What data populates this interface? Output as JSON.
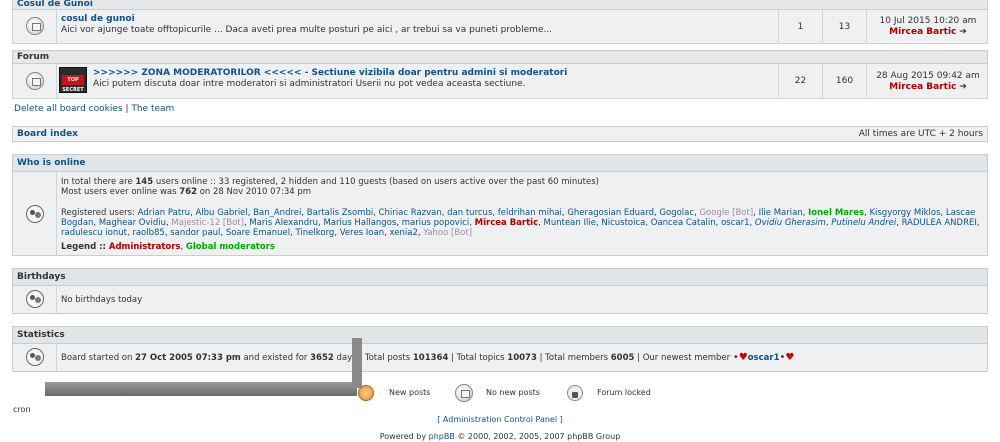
{
  "cat_gunoi": {
    "header": "Cosul de Gunoi",
    "forum_title": "cosul de gunoi",
    "forum_desc": "Aici vor ajunge toate offtopicurile ... Daca aveti prea multe posturi pe aici , ar trebui sa va puneti probleme...",
    "topics": "1",
    "posts": "13",
    "last_date": "10 Jul 2015 10:20 am",
    "last_user": "Mircea Bartic"
  },
  "cat_forum": {
    "header": "Forum",
    "image_text": "TOP SECRET",
    "forum_title": ">>>>>> ZONA MODERATORILOR <<<<< - Sectiune vizibila doar pentru admini si moderatori",
    "forum_desc": "Aici putem discuta doar intre moderatori si administratori Userii nu pot vedea aceasta sectiune.",
    "topics": "22",
    "posts": "160",
    "last_date": "28 Aug 2015 09:42 am",
    "last_user": "Mircea Bartic"
  },
  "links": {
    "delete_cookies": "Delete all board cookies",
    "separator": "|",
    "team": "The team"
  },
  "navbar": {
    "board_index": "Board index",
    "timezone": "All times are UTC + 2 hours"
  },
  "online": {
    "header": "Who is online",
    "line1_a": "In total there are ",
    "line1_count": "145",
    "line1_b": " users online :: 33 registered, 2 hidden and 110 guests (based on users active over the past 60 minutes)",
    "line2_a": "Most users ever online was ",
    "line2_count": "762",
    "line2_b": " on 28 Nov 2010 07:34 pm",
    "registered_label": "Registered users: ",
    "users": [
      {
        "name": "Adrian Patru",
        "type": "user"
      },
      {
        "name": "Albu Gabriel",
        "type": "user"
      },
      {
        "name": "Ban_Andrei",
        "type": "user"
      },
      {
        "name": "Bartalis Zsombi",
        "type": "user"
      },
      {
        "name": "Chiriac Razvan",
        "type": "user"
      },
      {
        "name": "dan turcus",
        "type": "user"
      },
      {
        "name": "feldrihan mihai",
        "type": "user"
      },
      {
        "name": "Gheragosian Eduard",
        "type": "user"
      },
      {
        "name": "Gogolac",
        "type": "user"
      },
      {
        "name": "Google [Bot]",
        "type": "bot"
      },
      {
        "name": "Ilie Marian",
        "type": "user"
      },
      {
        "name": "Ionel Mares",
        "type": "mod"
      },
      {
        "name": "Kisgyorgy Miklos",
        "type": "user"
      },
      {
        "name": "Lascae Bogdan",
        "type": "user"
      },
      {
        "name": "Maghear Ovidiu",
        "type": "user"
      },
      {
        "name": "Majestic-12 [Bot]",
        "type": "bot"
      },
      {
        "name": "Maris Alexandru",
        "type": "user"
      },
      {
        "name": "Marius Hallangos",
        "type": "user"
      },
      {
        "name": "marius popovici",
        "type": "user"
      },
      {
        "name": "Mircea Bartic",
        "type": "admin"
      },
      {
        "name": "Muntean Ilie",
        "type": "user"
      },
      {
        "name": "Nicustoica",
        "type": "user"
      },
      {
        "name": "Oancea Catalin",
        "type": "user"
      },
      {
        "name": "oscar1",
        "type": "user"
      },
      {
        "name": "Ovidiu Gherasim",
        "type": "italic"
      },
      {
        "name": "Putinelu Andrei",
        "type": "italic"
      },
      {
        "name": "RADULEA ANDREI",
        "type": "user"
      },
      {
        "name": "radulescu ionut",
        "type": "user"
      },
      {
        "name": "raolb85",
        "type": "user"
      },
      {
        "name": "sandor paul",
        "type": "user"
      },
      {
        "name": "Soare Emanuel",
        "type": "user"
      },
      {
        "name": "Tinelkorg",
        "type": "user"
      },
      {
        "name": "Veres Ioan",
        "type": "user"
      },
      {
        "name": "xenia2",
        "type": "user"
      },
      {
        "name": "Yahoo [Bot]",
        "type": "bot"
      }
    ],
    "legend_label": "Legend :: ",
    "legend_admins": "Administrators",
    "legend_sep": ", ",
    "legend_mods": "Global moderators"
  },
  "birthdays": {
    "header": "Birthdays",
    "text": "No birthdays today"
  },
  "stats": {
    "header": "Statistics",
    "a": "Board started on ",
    "started": "27 Oct 2005 07:33 pm",
    "b": " and existed for ",
    "days": "3652",
    "c": " days | Total posts ",
    "posts": "101364",
    "d": " | Total topics ",
    "topics": "10073",
    "e": " | Total members ",
    "members": "6005",
    "f": " | Our newest member ",
    "newest": "oscar1"
  },
  "legend_icons": {
    "new_posts": "New posts",
    "no_new_posts": "No new posts",
    "forum_locked": "Forum locked"
  },
  "footer": {
    "cron": "cron",
    "acp": "[ Administration Control Panel ]",
    "powered_a": "Powered by ",
    "phpbb": "phpBB",
    "powered_b": " © 2000, 2002, 2005, 2007 phpBB Group"
  },
  "colors": {
    "link": "#105289",
    "admin": "#aa0000",
    "mod": "#00aa00",
    "bot": "#9e8da7"
  }
}
